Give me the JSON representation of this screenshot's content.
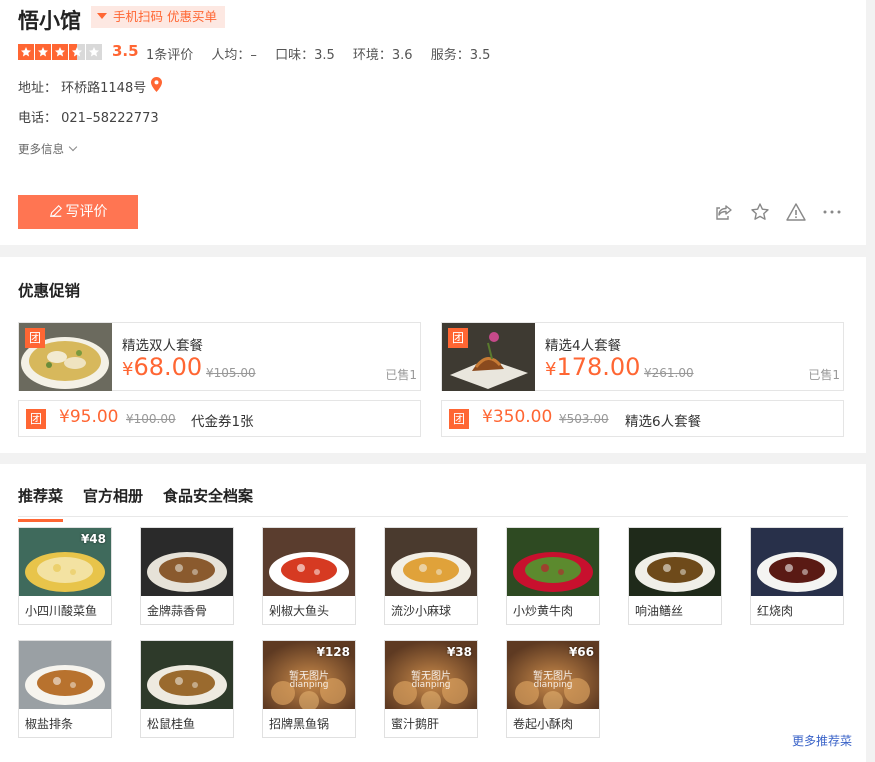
{
  "shop": {
    "name": "悟小馆",
    "scan_tag": "手机扫码 优惠买单",
    "score": "3.5",
    "star_rating": 3.5,
    "review_count": "1条评价",
    "avg_price": "人均：–",
    "taste": "口味：3.5",
    "environment": "环境：3.6",
    "service": "服务：3.5",
    "address": "地址：  环桥路1148号",
    "phone": "电话：  021–58222773",
    "more_info": "更多信息",
    "write_review": "写评价"
  },
  "promo": {
    "title": "优惠促销",
    "tuan_label": "团",
    "deals": [
      {
        "name": "精选双人套餐",
        "yen": "¥",
        "price": "68.00",
        "original": "¥105.00",
        "sold": "已售1"
      },
      {
        "name": "精选4人套餐",
        "yen": "¥",
        "price": "178.00",
        "original": "¥261.00",
        "sold": "已售1"
      }
    ],
    "vouchers": [
      {
        "price": "¥95.00",
        "original": "¥100.00",
        "name": "代金券1张"
      },
      {
        "price": "¥350.00",
        "original": "¥503.00",
        "name": "精选6人套餐"
      }
    ]
  },
  "dishes_section": {
    "tabs": [
      "推荐菜",
      "官方相册",
      "食品安全档案"
    ],
    "active_tab": "推荐菜",
    "more": "更多推荐菜",
    "dishes": [
      {
        "name": "小四川酸菜鱼",
        "price": "¥48",
        "has_photo": true
      },
      {
        "name": "金牌蒜香骨",
        "price": "",
        "has_photo": true
      },
      {
        "name": "剁椒大鱼头",
        "price": "",
        "has_photo": true
      },
      {
        "name": "流沙小麻球",
        "price": "",
        "has_photo": true
      },
      {
        "name": "小炒黄牛肉",
        "price": "",
        "has_photo": true
      },
      {
        "name": "响油鳝丝",
        "price": "",
        "has_photo": true
      },
      {
        "name": "红烧肉",
        "price": "",
        "has_photo": true
      },
      {
        "name": "椒盐排条",
        "price": "",
        "has_photo": true
      },
      {
        "name": "松鼠桂鱼",
        "price": "",
        "has_photo": true
      },
      {
        "name": "招牌黑鱼锅",
        "price": "¥128",
        "has_photo": false
      },
      {
        "name": "蜜汁鹅肝",
        "price": "¥38",
        "has_photo": false
      },
      {
        "name": "卷起小酥肉",
        "price": "¥66",
        "has_photo": false
      }
    ],
    "placeholder_text": "暂无图片",
    "placeholder_sub": "dianping"
  },
  "colors": {
    "accent": "#ff6633",
    "button": "#ff7552",
    "link": "#3a63c8"
  }
}
